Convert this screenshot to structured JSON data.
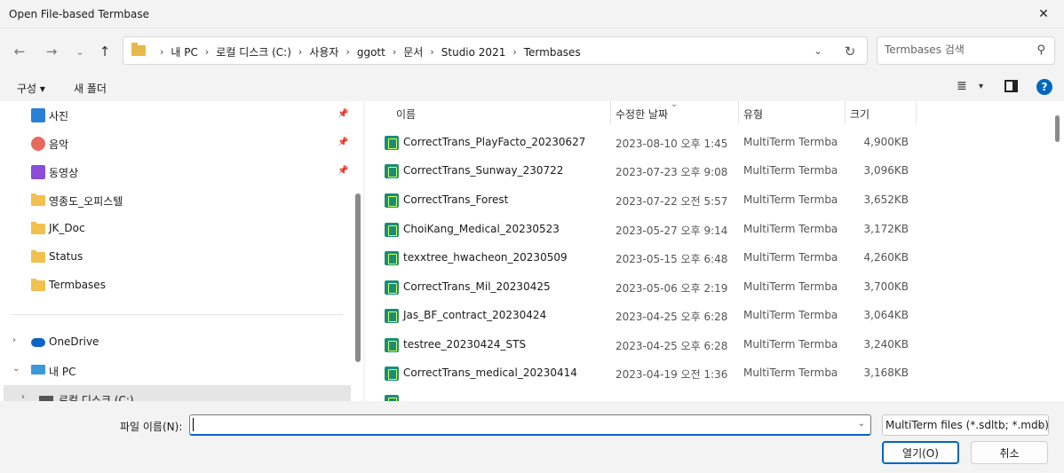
{
  "window": {
    "title": "Open File-based Termbase"
  },
  "address": {
    "crumbs": [
      "내 PC",
      "로컬 디스크 (C:)",
      "사용자",
      "ggott",
      "문서",
      "Studio 2021",
      "Termbases"
    ]
  },
  "search": {
    "placeholder": "Termbases 검색"
  },
  "toolbar": {
    "organize": "구성 ▾",
    "new_folder": "새 폴더"
  },
  "sidebar": {
    "quick": [
      {
        "label": "사진",
        "icon": "pictures-icon",
        "pinned": true
      },
      {
        "label": "음악",
        "icon": "music-icon",
        "pinned": true
      },
      {
        "label": "동영상",
        "icon": "videos-icon",
        "pinned": true
      },
      {
        "label": "영종도_오피스텔",
        "icon": "folder-icon"
      },
      {
        "label": "JK_Doc",
        "icon": "folder-icon"
      },
      {
        "label": "Status",
        "icon": "folder-icon"
      },
      {
        "label": "Termbases",
        "icon": "folder-icon"
      }
    ],
    "onedrive": "OneDrive",
    "this_pc": "내 PC",
    "local_disk": "로컬 디스크 (C:)"
  },
  "columns": {
    "name": "이름",
    "modified": "수정한 날짜",
    "type": "유형",
    "size": "크기"
  },
  "files": [
    {
      "name": "CorrectTrans_PlayFacto_20230627",
      "modified": "2023-08-10 오후 1:45",
      "type": "MultiTerm Termbase",
      "size": "4,900KB"
    },
    {
      "name": "CorrectTrans_Sunway_230722",
      "modified": "2023-07-23 오후 9:08",
      "type": "MultiTerm Termbase",
      "size": "3,096KB"
    },
    {
      "name": "CorrectTrans_Forest",
      "modified": "2023-07-22 오전 5:57",
      "type": "MultiTerm Termbase",
      "size": "3,652KB"
    },
    {
      "name": "ChoiKang_Medical_20230523",
      "modified": "2023-05-27 오후 9:14",
      "type": "MultiTerm Termbase",
      "size": "3,172KB"
    },
    {
      "name": "texxtree_hwacheon_20230509",
      "modified": "2023-05-15 오후 6:48",
      "type": "MultiTerm Termbase",
      "size": "4,260KB"
    },
    {
      "name": "CorrectTrans_Mil_20230425",
      "modified": "2023-05-06 오후 2:19",
      "type": "MultiTerm Termbase",
      "size": "3,700KB"
    },
    {
      "name": "Jas_BF_contract_20230424",
      "modified": "2023-04-25 오후 6:28",
      "type": "MultiTerm Termbase",
      "size": "3,064KB"
    },
    {
      "name": "testree_20230424_STS",
      "modified": "2023-04-25 오후 6:28",
      "type": "MultiTerm Termbase",
      "size": "3,240KB"
    },
    {
      "name": "CorrectTrans_medical_20230414",
      "modified": "2023-04-19 오전 1:36",
      "type": "MultiTerm Termbase",
      "size": "3,168KB"
    }
  ],
  "bottom": {
    "filename_label": "파일 이름(N):",
    "filename_value": "",
    "filter": "MultiTerm files (*.sdltb; *.mdb)",
    "open_button": "열기(O)",
    "cancel_button": "취소"
  }
}
